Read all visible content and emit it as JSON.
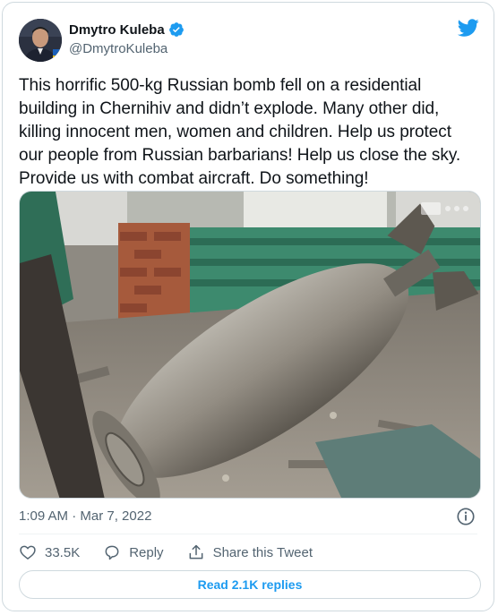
{
  "author": {
    "name": "Dmytro Kuleba",
    "handle": "@DmytroKuleba",
    "verified": true
  },
  "tweet": {
    "text": "This horrific 500-kg Russian bomb fell on a residential building in Chernihiv and didn’t explode. Many other did, killing innocent men, women and children. Help us protect our people from Russian barbarians! Help us close the sky. Provide us with combat aircraft. Do something!",
    "timestamp": "1:09 AM · Mar 7, 2022"
  },
  "actions": {
    "like_count": "33.5K",
    "reply_label": "Reply",
    "share_label": "Share this Tweet"
  },
  "read_replies_label": "Read 2.1K replies",
  "colors": {
    "accent": "#1d9bf0",
    "text": "#0f1419",
    "secondary": "#536471",
    "border": "#cfd9de"
  },
  "icons": [
    "twitter-bird-icon",
    "verified-badge-icon",
    "info-icon",
    "heart-icon",
    "reply-icon",
    "share-icon"
  ]
}
